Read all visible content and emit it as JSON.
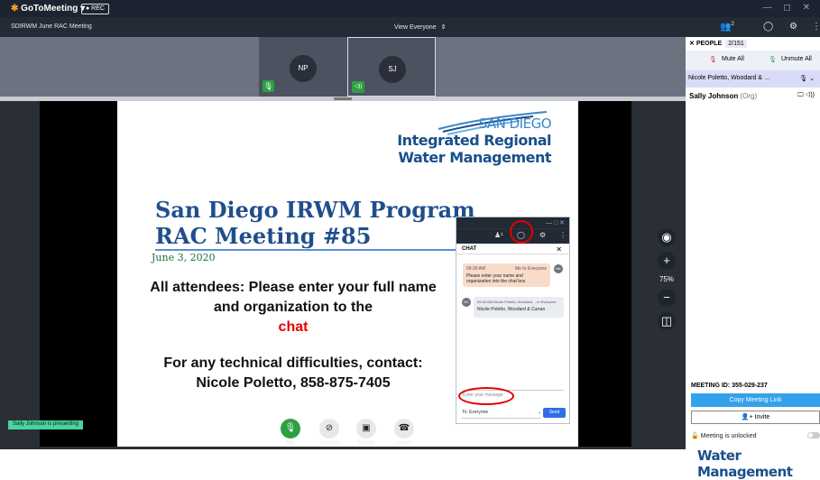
{
  "titlebar": {
    "logo": "GoToMeeting",
    "logo_caret": "▾",
    "rec": "● REC",
    "window_controls": "— ◻ ✕"
  },
  "topbar": {
    "meeting_title": "SDIRWM June RAC Meeting",
    "view_everyone": "View Everyone",
    "view_icon": "⇕"
  },
  "tiles": [
    {
      "initials": "NP",
      "badge": "mic-active-icon"
    },
    {
      "initials": "SJ",
      "badge": "speaker-icon"
    }
  ],
  "slide": {
    "logo_line1": "SAN DIEGO",
    "logo_line2": "Integrated Regional",
    "logo_line3": "Water Management",
    "title_line1": "San Diego IRWM Program",
    "title_line2": "RAC Meeting #85",
    "date": "June 3, 2020",
    "body1_prefix": "All attendees: Please enter your full name and organization to the",
    "body1_highlight": "chat",
    "body2": "For any technical difficulties, contact: Nicole Poletto, 858-875-7405"
  },
  "zoom": {
    "camera": "◉",
    "plus": "+",
    "percent": "75%",
    "minus": "−",
    "fit": "◫"
  },
  "presenting": "Sally Johnson is presenting",
  "controls": [
    {
      "label": "Mic",
      "icon": "mic-icon",
      "glyph": "🎙"
    },
    {
      "label": "Camera",
      "icon": "camera-off-icon",
      "glyph": "⊘"
    },
    {
      "label": "Screen",
      "icon": "screen-icon",
      "glyph": "▣"
    },
    {
      "label": "Leave",
      "icon": "hangup-icon",
      "glyph": "☎"
    }
  ],
  "chat": {
    "win_controls": "— □ ✕",
    "title": "CHAT",
    "close": "✕",
    "toolbar_people": "♟¹",
    "toolbar_chat": "◯",
    "toolbar_gear": "⚙",
    "toolbar_more": "⋮",
    "msg1_time": "09:30 AM",
    "msg1_meta": "Me to Everyone",
    "msg1_text": "Please enter your name and organization into the chat box",
    "msg1_avatar": "Me",
    "msg2_avatar": "NC",
    "msg2_meta": "09:30 AM Nicole Poletto, Woodard… to Everyone",
    "msg2_text": "Nicole Poletto, Woodard & Curran",
    "input_placeholder": "Enter your message",
    "to_label": "To:",
    "to_value": "Everyone",
    "to_caret": "⌄",
    "send": "Send"
  },
  "people": {
    "icon_count": "2",
    "header": "PEOPLE",
    "count": "2/151",
    "close": "✕",
    "mute_all": "Mute All",
    "unmute_all": "Unmute All",
    "group": "Nicole Poletto, Woodard & …",
    "group_icons": "🎙 ⌄",
    "member_name": "Sally Johnson",
    "member_org": "(Org)",
    "member_icons": "🖵 ◁))"
  },
  "meeting": {
    "id_label": "MEETING ID: 355-029-237",
    "copy_link": "Copy Meeting Link",
    "invite": "Invite",
    "invite_icon": "👤+",
    "lock_text": "Meeting is unlocked"
  },
  "watermark": "Water Management"
}
